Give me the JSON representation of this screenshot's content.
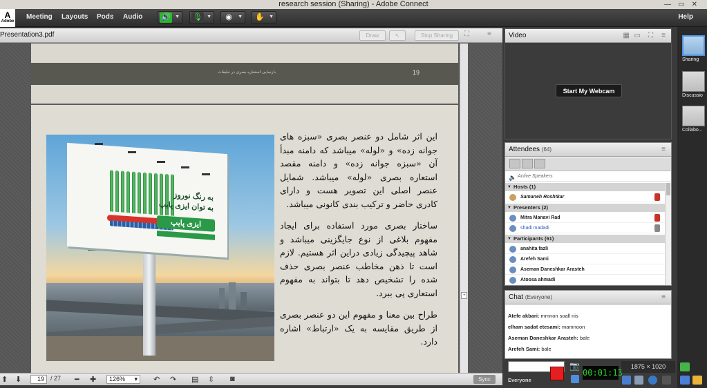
{
  "window": {
    "title": "research session (Sharing) - Adobe Connect"
  },
  "logo": {
    "mark": "A",
    "text": "Adobe"
  },
  "menu": {
    "items": [
      "Meeting",
      "Layouts",
      "Pods",
      "Audio"
    ],
    "help": "Help"
  },
  "presentation": {
    "title": "Presentation3.pdf",
    "buttons": {
      "draw": "Draw",
      "stop_sharing": "Stop Sharing"
    },
    "prev_slide": {
      "header_text": "بازنمایی استعاره بصری در تبلیغات",
      "page_number": "19"
    },
    "billboard": {
      "line1": "به رنگ نوروز",
      "line2": "به توان ایزی پایپ",
      "brand": "ایزی پایپ"
    },
    "paragraphs": [
      "این اثر شامل دو عنصر بصری «سبزه های جوانه زده» و «لوله» میباشد که دامنه مبدأ آن «سبزه جوانه زده» و دامنه مقصد استعاره بصری «لوله» میباشد. شمایل عنصر اصلی این تصویر هست و دارای کادری حاضر و ترکیب بندی کانونی میباشد.",
      "ساختار بصری مورد استفاده برای ایجاد مفهوم بلاغی از نوع جایگزینی میباشد و شاهد پیچیدگی زیادی دراین اثر هستیم. لازم است تا ذهن مخاطب عنصر بصری حذف شده را تشخیص دهد تا بتواند به مفهوم استعاری پی ببرد.",
      "طراح بین معنا و مفهوم این دو عنصر بصری از طریق مقایسه به یک «ارتباط» اشاره دارد."
    ],
    "footer": {
      "page": "19",
      "total": "/ 27",
      "zoom": "126%",
      "sync": "Sync"
    }
  },
  "video": {
    "title": "Video",
    "webcam_button": "Start My Webcam"
  },
  "attendees": {
    "title": "Attendees",
    "count": "(64)",
    "active_speakers": "Active Speakers",
    "groups": {
      "hosts": {
        "label": "Hosts (1)",
        "users": [
          "Samaneh Roshtkar"
        ]
      },
      "presenters": {
        "label": "Presenters (2)",
        "users": [
          "Mitra Manavi Rad",
          "shadi madadi"
        ]
      },
      "participants": {
        "label": "Participants (61)",
        "users": [
          "anahita fazli",
          "Arefeh Sami",
          "Aseman Daneshkar Arasteh",
          "Atoosa ahmadi"
        ]
      }
    }
  },
  "chat": {
    "title": "Chat",
    "scope": "(Everyone)",
    "messages": [
      {
        "sender": "Atefe akbari:",
        "text": "mmnon soall nis"
      },
      {
        "sender": "elham sadat etesami:",
        "text": "mamnoon"
      },
      {
        "sender": "Aseman Daneshkar Arasteh:",
        "text": "bale"
      },
      {
        "sender": "Arefeh Sami:",
        "text": "bale"
      }
    ],
    "to": "Everyone"
  },
  "recorder": {
    "timer": "00:01:13",
    "resolution": "1875 × 1020"
  },
  "layouts": [
    {
      "label": "Sharing",
      "active": true
    },
    {
      "label": "Discussio",
      "active": false
    },
    {
      "label": "Collabo...",
      "active": false
    }
  ],
  "colors": {
    "accent": "#4f93e0",
    "record": "#e51f1f",
    "timer": "#26d326"
  }
}
